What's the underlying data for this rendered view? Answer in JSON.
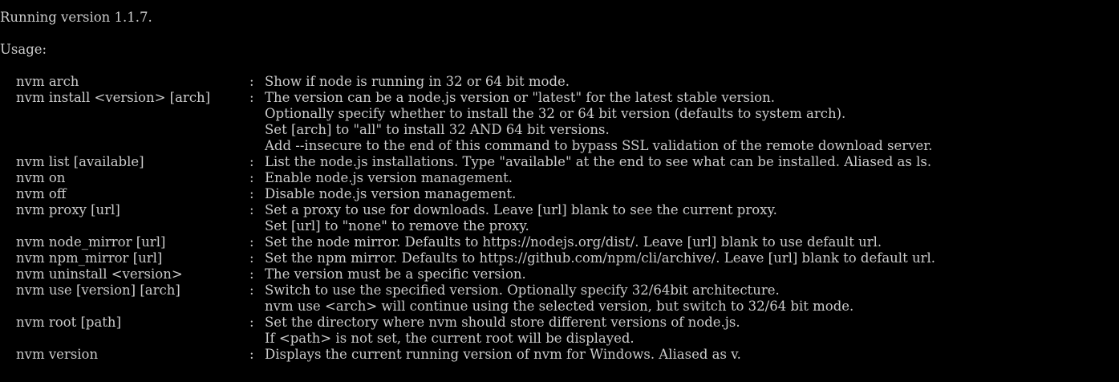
{
  "header": {
    "version_line": "Running version 1.1.7.",
    "usage_label": "Usage:"
  },
  "separator": ":",
  "commands": [
    {
      "cmd": "nvm arch",
      "lines": [
        "Show if node is running in 32 or 64 bit mode."
      ]
    },
    {
      "cmd": "nvm install <version> [arch]",
      "lines": [
        "The version can be a node.js version or \"latest\" for the latest stable version.",
        "Optionally specify whether to install the 32 or 64 bit version (defaults to system arch).",
        "Set [arch] to \"all\" to install 32 AND 64 bit versions.",
        "Add --insecure to the end of this command to bypass SSL validation of the remote download server."
      ]
    },
    {
      "cmd": "nvm list [available]",
      "lines": [
        "List the node.js installations. Type \"available\" at the end to see what can be installed. Aliased as ls."
      ]
    },
    {
      "cmd": "nvm on",
      "lines": [
        "Enable node.js version management."
      ]
    },
    {
      "cmd": "nvm off",
      "lines": [
        "Disable node.js version management."
      ]
    },
    {
      "cmd": "nvm proxy [url]",
      "lines": [
        "Set a proxy to use for downloads. Leave [url] blank to see the current proxy.",
        "Set [url] to \"none\" to remove the proxy."
      ]
    },
    {
      "cmd": "nvm node_mirror [url]",
      "lines": [
        "Set the node mirror. Defaults to https://nodejs.org/dist/. Leave [url] blank to use default url."
      ]
    },
    {
      "cmd": "nvm npm_mirror [url]",
      "lines": [
        "Set the npm mirror. Defaults to https://github.com/npm/cli/archive/. Leave [url] blank to default url."
      ]
    },
    {
      "cmd": "nvm uninstall <version>",
      "lines": [
        "The version must be a specific version."
      ]
    },
    {
      "cmd": "nvm use [version] [arch]",
      "lines": [
        "Switch to use the specified version. Optionally specify 32/64bit architecture.",
        "nvm use <arch> will continue using the selected version, but switch to 32/64 bit mode."
      ]
    },
    {
      "cmd": "nvm root [path]",
      "lines": [
        "Set the directory where nvm should store different versions of node.js.",
        "If <path> is not set, the current root will be displayed."
      ]
    },
    {
      "cmd": "nvm version",
      "lines": [
        "Displays the current running version of nvm for Windows. Aliased as v."
      ]
    }
  ]
}
